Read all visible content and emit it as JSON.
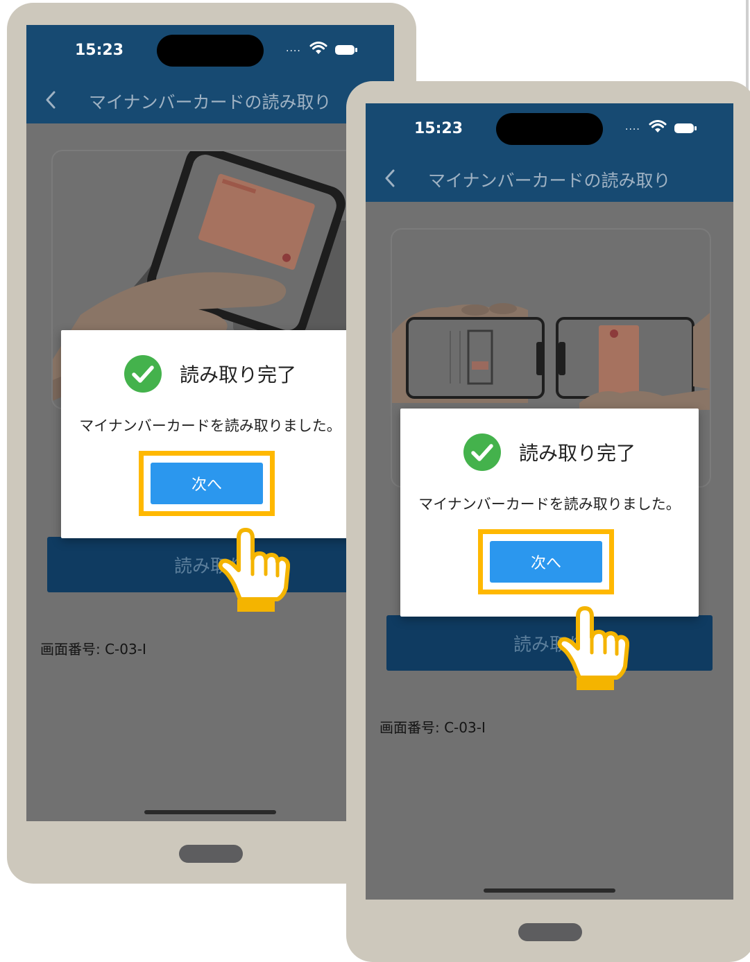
{
  "phones": [
    {
      "status_time": "15:23",
      "signal_text": "....",
      "header_title": "マイナンバーカードの読み取り",
      "dialog_title": "読み取り完了",
      "dialog_message": "マイナンバーカードを読み取りました。",
      "next_label": "次へ",
      "action_label": "読み取り",
      "screen_id": "画面番号: C-03-I"
    },
    {
      "status_time": "15:23",
      "signal_text": "....",
      "header_title": "マイナンバーカードの読み取り",
      "dialog_title": "読み取り完了",
      "dialog_message": "マイナンバーカードを読み取りました。",
      "next_label": "次へ",
      "action_label": "読み取り",
      "screen_id": "画面番号: C-03-I"
    }
  ],
  "colors": {
    "header": "#174a72",
    "highlight": "#ffb800",
    "primary_button": "#2b97ee",
    "success": "#44b24c",
    "phone_frame": "#cdc8bc"
  }
}
